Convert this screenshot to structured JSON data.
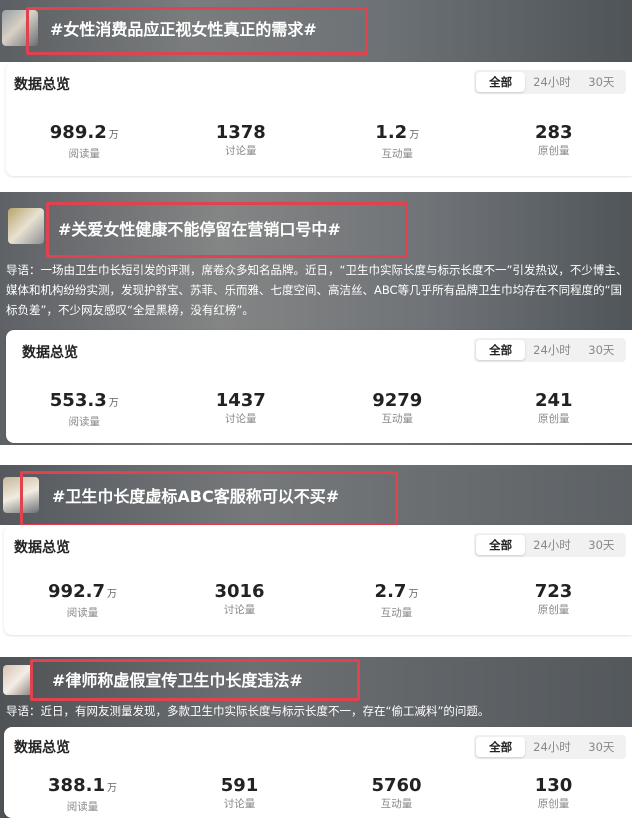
{
  "tabs": [
    "全部",
    "24小时",
    "30天"
  ],
  "card_title": "数据总览",
  "labels": {
    "read": "阅读量",
    "discuss": "讨论量",
    "interact": "互动量",
    "original": "原创量"
  },
  "unit_wan": "万",
  "topics": [
    {
      "tag": "#女性消费品应正视女性真正的需求#",
      "stats": {
        "read": "989.2",
        "discuss": "1378",
        "interact": "1.2",
        "original": "283"
      }
    },
    {
      "tag": "#关爱女性健康不能停留在营销口号中#",
      "intro": "导语：一场由卫生巾长短引发的评测，席卷众多知名品牌。近日，“卫生巾实际长度与标示长度不一”引发热议，不少博主、媒体和机构纷纷实测，发现护舒宝、苏菲、乐而雅、七度空间、高洁丝、ABC等几乎所有品牌卫生巾均存在不同程度的“国标负差”，不少网友感叹“全是黑榜，没有红榜”。",
      "stats": {
        "read": "553.3",
        "discuss": "1437",
        "interact": "9279",
        "original": "241"
      }
    },
    {
      "tag": "#卫生巾长度虚标ABC客服称可以不买#",
      "stats": {
        "read": "992.7",
        "discuss": "3016",
        "interact": "2.7",
        "original": "723"
      }
    },
    {
      "tag": "#律师称虚假宣传卫生巾长度违法#",
      "intro": "导语：近日，有网友测量发现，多款卫生巾实际长度与标示长度不一，存在“偷工减料”的问题。",
      "stats": {
        "read": "388.1",
        "discuss": "591",
        "interact": "5760",
        "original": "130"
      }
    }
  ]
}
